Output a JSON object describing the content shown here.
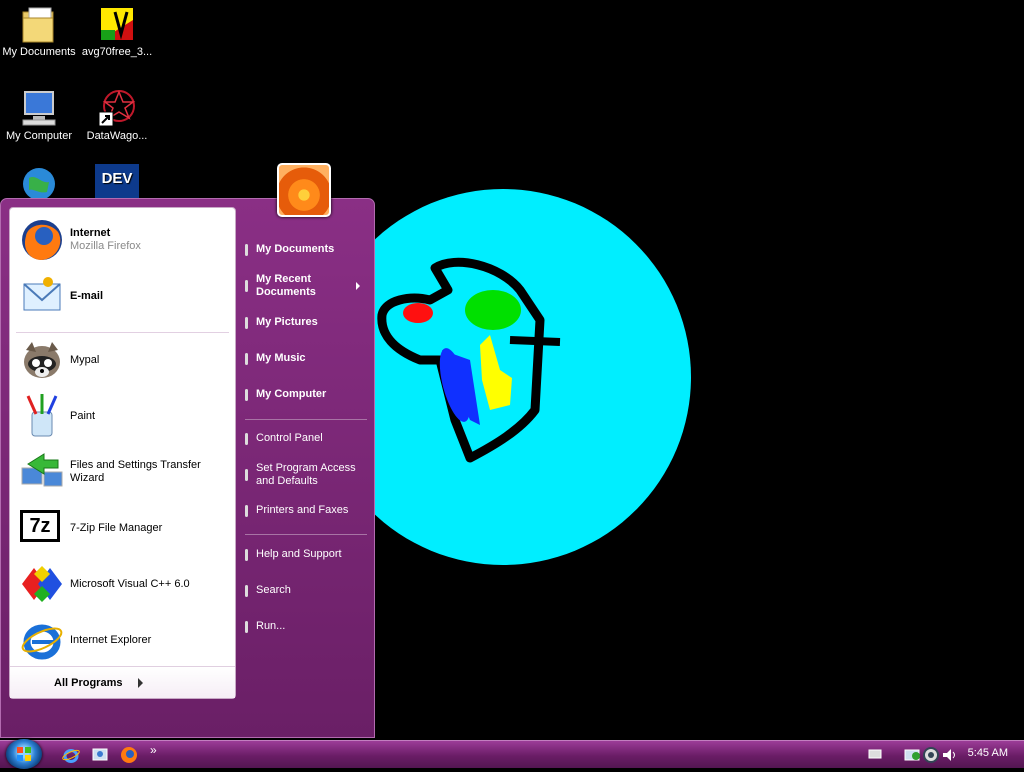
{
  "desktop": {
    "icons": [
      {
        "label": "My Documents"
      },
      {
        "label": "avg70free_3..."
      },
      {
        "label": "My Computer"
      },
      {
        "label": "DataWago..."
      },
      {
        "label": ""
      },
      {
        "label": ""
      }
    ],
    "dev_icon_text": "DEV"
  },
  "start_menu": {
    "pinned": [
      {
        "title": "Internet",
        "subtitle": "Mozilla Firefox",
        "icon": "firefox-icon"
      },
      {
        "title": "E-mail",
        "subtitle": "",
        "icon": "email-icon"
      }
    ],
    "recent": [
      {
        "label": "Mypal",
        "icon": "mypal-raccoon-icon"
      },
      {
        "label": "Paint",
        "icon": "paint-icon"
      },
      {
        "label": "Files and Settings Transfer Wizard",
        "icon": "transfer-wizard-icon"
      },
      {
        "label": "7-Zip File Manager",
        "icon": "7zip-icon",
        "icon_text": "7z"
      },
      {
        "label": "Microsoft Visual C++ 6.0",
        "icon": "visual-cpp-icon"
      },
      {
        "label": "Internet Explorer",
        "icon": "internet-explorer-icon"
      }
    ],
    "all_programs": "All Programs",
    "right": [
      {
        "label": "My Documents"
      },
      {
        "label": "My Recent Documents"
      },
      {
        "label": "My Pictures"
      },
      {
        "label": "My Music"
      },
      {
        "label": "My Computer"
      },
      {
        "label": "Control Panel"
      },
      {
        "label": "Set Program Access and Defaults"
      },
      {
        "label": "Printers and Faxes"
      },
      {
        "label": "Help and Support"
      },
      {
        "label": "Search"
      },
      {
        "label": "Run..."
      }
    ]
  },
  "taskbar": {
    "quick_launch": [
      "internet-explorer-icon",
      "show-desktop-icon",
      "firefox-icon"
    ],
    "overflow": "»",
    "tray": [
      "keyboard-icon",
      "network-icon",
      "quicktime-icon",
      "volume-icon"
    ],
    "clock": "5:45 AM"
  },
  "colors": {
    "accent": "#7a2876",
    "wallpaper_circle": "#00f0ff"
  }
}
